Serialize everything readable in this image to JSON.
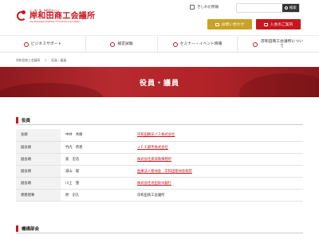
{
  "header": {
    "logo_tag": "人・夢・街、岸和田みらい。",
    "logo_name": "岸和田商工会議所",
    "logo_en": "The Kishiwada Chamber of Commerce & Industry",
    "minutes_link": "きしわだ所報",
    "search_placeholder": "",
    "search_label": "検索",
    "contact_label": "お問い合わせ",
    "join_label": "入会のご案内"
  },
  "nav": {
    "items": [
      {
        "label": "ビジネスサポート",
        "icon": "building-icon"
      },
      {
        "label": "検定試験",
        "icon": "pen-icon"
      },
      {
        "label": "セミナー・イベント情報",
        "icon": "calendar-icon"
      },
      {
        "label": "岸和田商工会議所について",
        "icon": "info-icon"
      }
    ]
  },
  "breadcrumb": {
    "home": "岸和田商工会議所",
    "sep": "＞",
    "current": "役員・議員"
  },
  "hero": {
    "title": "役員・議員"
  },
  "section_officers": {
    "title": "役員",
    "rows": [
      {
        "role": "会頭",
        "name": "中井　秀樹",
        "org": "岸和田観光バス株式会社",
        "link": true
      },
      {
        "role": "副会頭",
        "name": "竹内　恭恵",
        "org": "ＪＦＥ鋼手株式会社",
        "link": true
      },
      {
        "role": "副会頭",
        "name": "奥　忠浩",
        "org": "株式会社奥保険事務所",
        "link": true
      },
      {
        "role": "副会頭",
        "name": "湯山　聡",
        "org": "医療法人徳洲会　岸和田徳洲会病院",
        "link": true
      },
      {
        "role": "副会頭",
        "name": "川上　豊",
        "org": "株式会社池田泉州銀行",
        "link": true
      },
      {
        "role": "専務理事",
        "name": "原　宗久",
        "org": "岸和田商工会議所",
        "link": false
      }
    ]
  },
  "section_next": {
    "title": "機構部会"
  },
  "colors": {
    "brand_red": "#c8161d",
    "gold": "#c9a227"
  }
}
